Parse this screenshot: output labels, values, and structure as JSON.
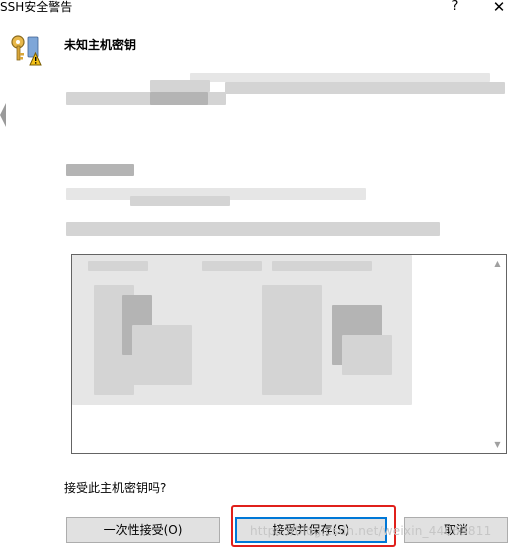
{
  "window": {
    "title": "SSH安全警告",
    "help_label": "?",
    "close_label": "✕"
  },
  "header": {
    "title": "未知主机密钥",
    "icon": "key-warning-icon"
  },
  "prompt": {
    "question": "接受此主机密钥吗?"
  },
  "buttons": {
    "accept_once": "一次性接受(O)",
    "accept_save": "接受并保存(S)",
    "cancel": "取消"
  },
  "watermark": "https://blog.csdn.net/weixin_44063811",
  "colors": {
    "focus_border": "#0078d7",
    "highlight_outline": "#e0201b",
    "button_face": "#e1e1e1"
  }
}
